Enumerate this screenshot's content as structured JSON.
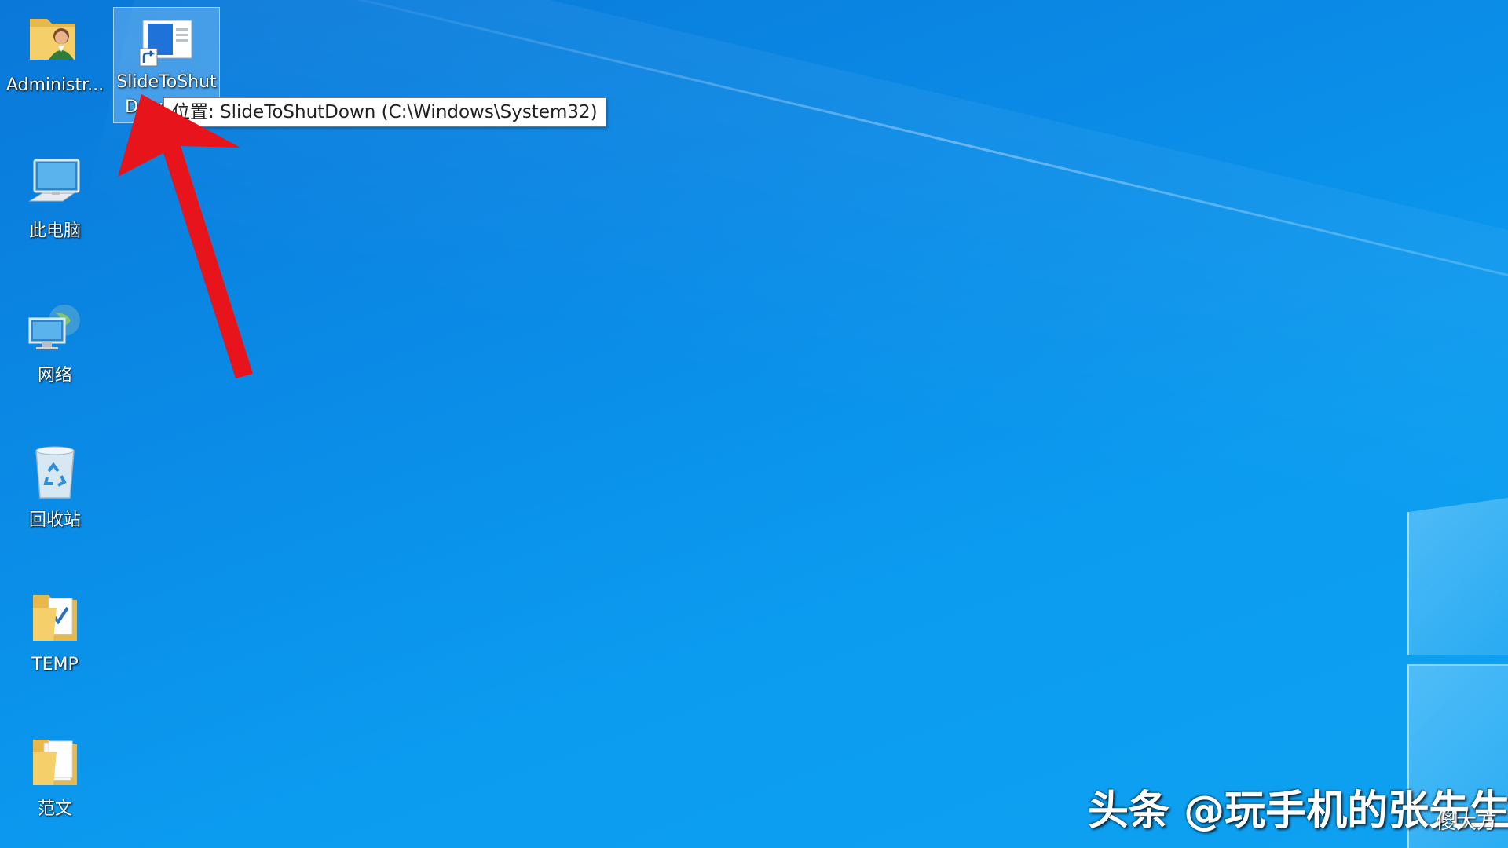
{
  "desktop": {
    "icons": [
      {
        "label": "Administr...",
        "icon": "user-folder-icon"
      },
      {
        "label": "SlideToShut",
        "label_line2": "Dow",
        "icon": "slide-to-shutdown-shortcut-icon",
        "selected": true
      },
      {
        "label": "此电脑",
        "icon": "computer-icon"
      },
      {
        "label": "网络",
        "icon": "network-icon"
      },
      {
        "label": "回收站",
        "icon": "recycle-bin-icon"
      },
      {
        "label": "TEMP",
        "icon": "temp-folder-icon"
      },
      {
        "label": "范文",
        "icon": "folder-icon"
      }
    ],
    "tooltip": "位置: SlideToShutDown (C:\\Windows\\System32)"
  },
  "annotation": {
    "arrow": "red-arrow",
    "color": "#e8141b"
  },
  "watermark": {
    "text": "头条 @玩手机的张先生",
    "corner_mark": "傻大方"
  },
  "colors": {
    "background": "#0b8fe9",
    "arrow": "#e8141b",
    "tooltip_bg": "#ffffff"
  }
}
